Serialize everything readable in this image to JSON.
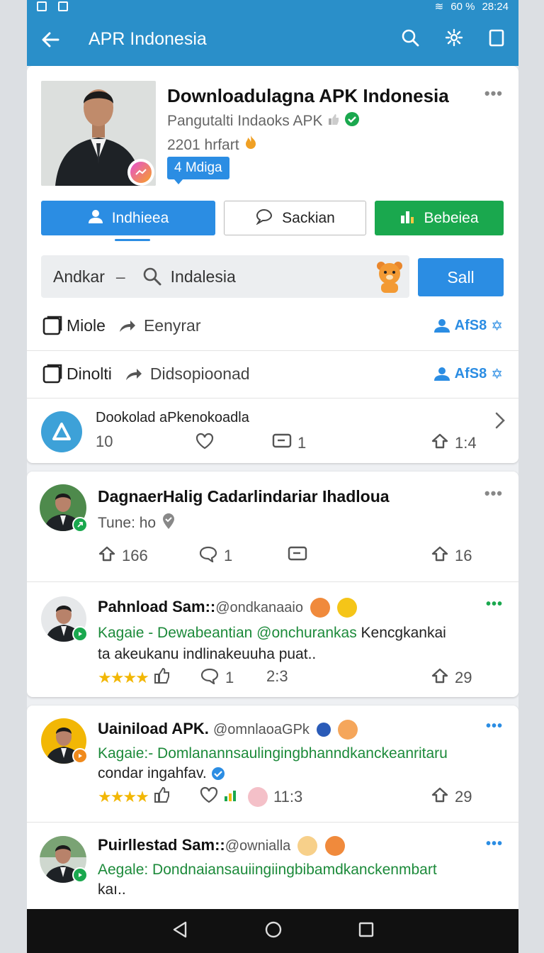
{
  "status_bar": {
    "battery": "60 %",
    "time": "28:24"
  },
  "app_bar": {
    "title": "APR Indonesia",
    "icons": [
      "back-arrow-icon",
      "search-icon",
      "settings-icon",
      "copy-icon"
    ]
  },
  "profile": {
    "title": "Downloadulagna APK Indonesia",
    "subtitle": "Pangutalti Indaoks APK",
    "count": "2201 hrfart",
    "chip": "4 Mdiga",
    "more": "•••"
  },
  "actions": {
    "primary": "Indhieea",
    "secondary": "Sackian",
    "tertiary": "Bebeiea"
  },
  "search": {
    "left_label": "Andkar",
    "dash": "–",
    "query": "Indalesia",
    "button": "Sall"
  },
  "link_rows": [
    {
      "primary": "Miole",
      "secondary": "Eenyrar",
      "right": "AfS8"
    },
    {
      "primary": "Dinolti",
      "secondary": "Didsopioonad",
      "right": "AfS8"
    }
  ],
  "app_row": {
    "title": "Dookolad aPkenokoadla",
    "count": "10",
    "comments": "1",
    "shares": "1:4"
  },
  "feed_card": {
    "title": "DagnaerHalig Cadarlindariar Ihadloua",
    "subtitle": "Tune: ho",
    "shares": "166",
    "comments": "1",
    "reposts": "16",
    "more": "•••"
  },
  "posts": [
    {
      "name": "Pahnload Sam::",
      "handle": "@ondkanaaio",
      "line1_green": "Kagaie - Dewabeantian @onchurankas",
      "line1_rest": " Kencgkankai",
      "line2": "ta akeukanu indlinakeuuha puat..",
      "comments": "1",
      "time": "2:3",
      "reposts": "29",
      "more": "•••",
      "accent": "#1aa84e"
    },
    {
      "name": "Uainiload APK.",
      "handle": "@omnlaoaGPk",
      "line1_green": "Kagaie:- Domlanannsaulingingbhanndkanckeanritaru",
      "line2": "condar ingahfav.",
      "time": "11:3",
      "reposts": "29",
      "more": "•••",
      "accent": "#f08a1c"
    },
    {
      "name": "Puirllestad Sam::",
      "handle": "@ownialla",
      "line1_green": "Aegale: Dondnaiansauiingiingbibamdkanckenmbart",
      "line2": "kaı..",
      "more": "•••",
      "accent": "#1aa84e"
    }
  ],
  "nav_icons": [
    "nav-back-icon",
    "nav-home-icon",
    "nav-recents-icon"
  ]
}
